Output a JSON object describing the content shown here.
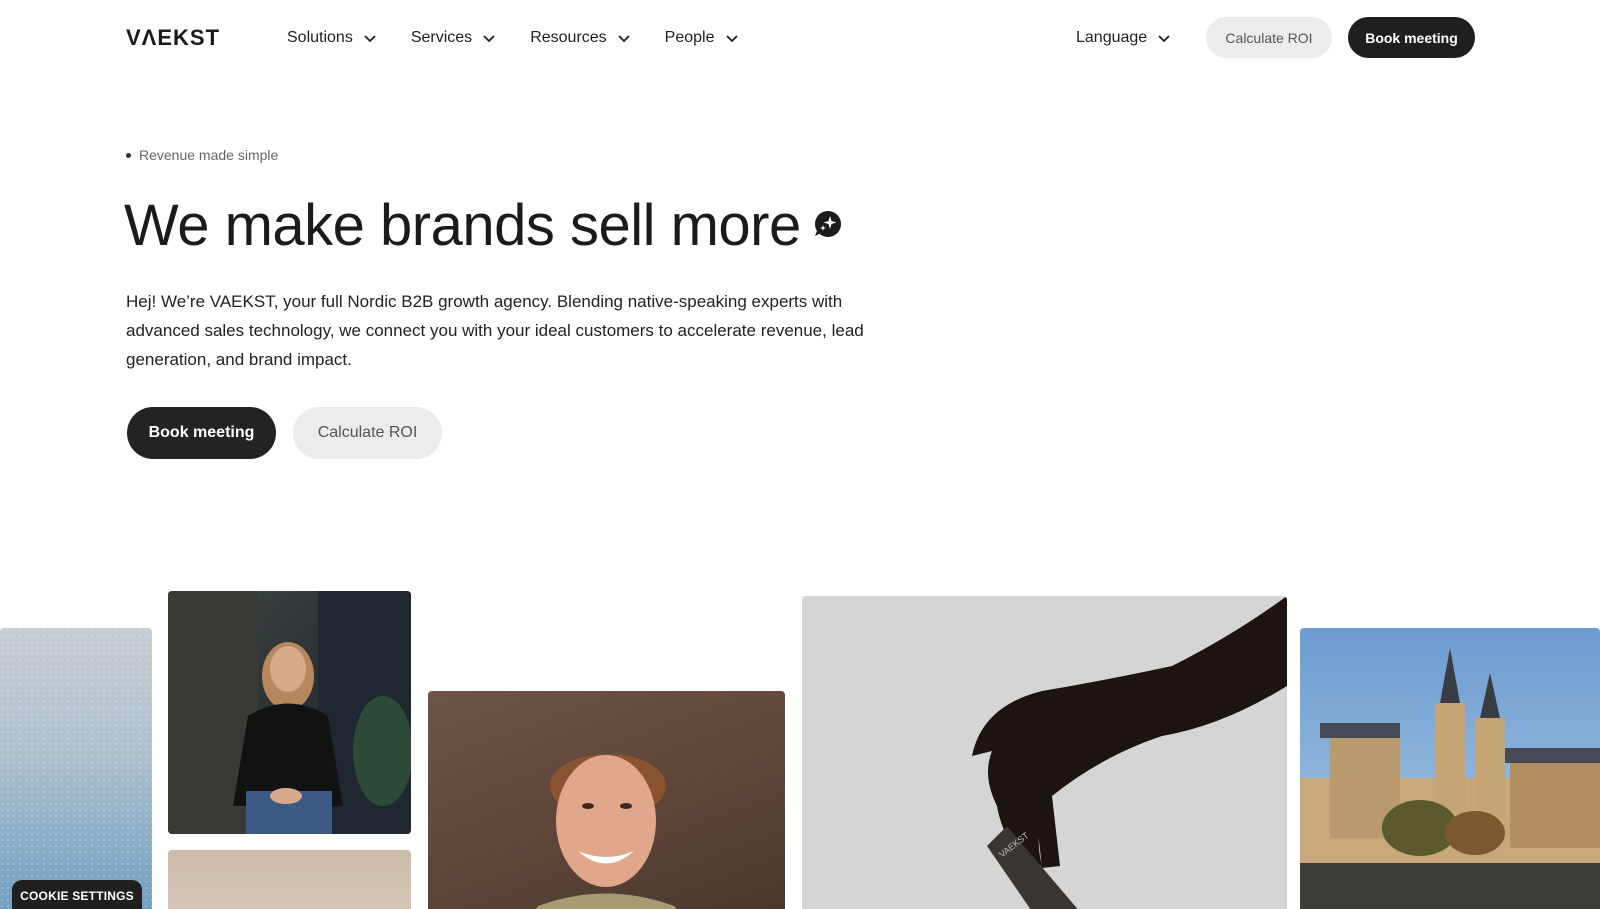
{
  "header": {
    "logo": "VΛEKST",
    "nav": [
      {
        "label": "Solutions"
      },
      {
        "label": "Services"
      },
      {
        "label": "Resources"
      },
      {
        "label": "People"
      }
    ],
    "language_label": "Language",
    "calc_roi_label": "Calculate ROI",
    "book_meeting_label": "Book meeting"
  },
  "hero": {
    "eyebrow": "Revenue made simple",
    "headline": "We make brands sell more",
    "lead": "Hej! We’re VAEKST, your full Nordic B2B growth agency. Blending native-speaking experts with advanced sales technology, we connect you with your ideal customers to accelerate revenue, lead generation, and brand impact.",
    "book_meeting_label": "Book meeting",
    "calc_roi_label": "Calculate ROI"
  },
  "gallery": {
    "card_text": "VAEKST"
  },
  "cookie_label": "COOKIE SETTINGS",
  "colors": {
    "primary_dark": "#1f1f1f",
    "secondary_light": "#ececec",
    "text": "#1c1c1c"
  }
}
